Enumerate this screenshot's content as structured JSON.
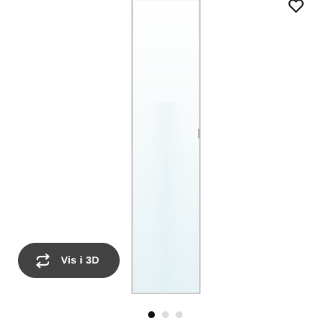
{
  "product": {
    "image_icon": "door-mirror-panel",
    "frame_color": "#b8b8b8",
    "glass_color_top": "#ffffff",
    "glass_color_bottom": "#e8f4f7"
  },
  "favorite": {
    "icon": "heart-outline-icon"
  },
  "view_3d": {
    "label": "Vis i 3D",
    "icon": "rotate-360-icon",
    "background_color": "#424242"
  },
  "carousel": {
    "total": 3,
    "active_index": 0,
    "active_color": "#111111",
    "inactive_color": "#dcdcdc"
  }
}
